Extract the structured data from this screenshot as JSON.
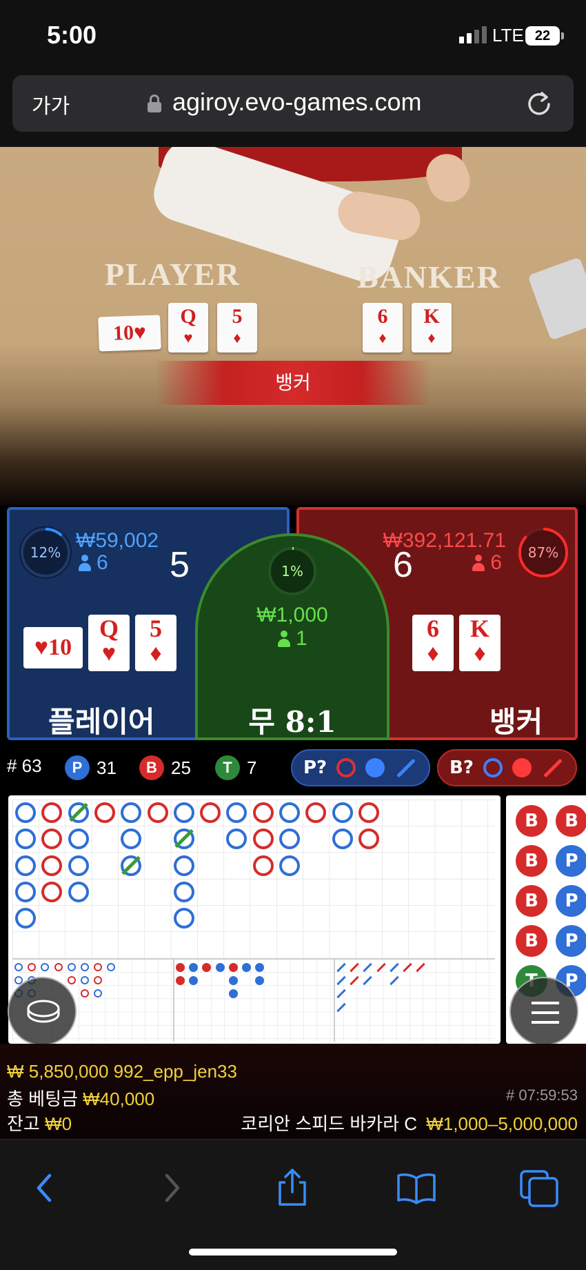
{
  "status": {
    "time": "5:00",
    "network": "LTE",
    "battery": "22"
  },
  "browser": {
    "aa": "가가",
    "url": "agiroy.evo-games.com"
  },
  "video": {
    "player_word": "PLAYER",
    "banker_word": "BANKER",
    "result_banner": "뱅커",
    "player_cards": [
      {
        "rank": "10",
        "suit": "♥"
      },
      {
        "rank": "Q",
        "suit": "♥"
      },
      {
        "rank": "5",
        "suit": "♦"
      }
    ],
    "banker_cards": [
      {
        "rank": "6",
        "suit": "♦"
      },
      {
        "rank": "K",
        "suit": "♦"
      }
    ]
  },
  "player": {
    "percent": "12%",
    "amount": "₩59,002",
    "bettors": "6",
    "score": "5",
    "cards": [
      {
        "rank": "10",
        "suit": "♥"
      },
      {
        "rank": "Q",
        "suit": "♥"
      },
      {
        "rank": "5",
        "suit": "♦"
      }
    ],
    "label": "플레이어",
    "percent_value": 12
  },
  "tie": {
    "percent": "1%",
    "amount": "₩1,000",
    "bettors": "1",
    "label": "무 8:1",
    "percent_value": 1
  },
  "banker": {
    "percent": "87%",
    "amount": "₩392,121.71",
    "bettors": "6",
    "score": "6",
    "cards": [
      {
        "rank": "6",
        "suit": "♦"
      },
      {
        "rank": "K",
        "suit": "♦"
      }
    ],
    "label": "뱅커",
    "percent_value": 87
  },
  "stats": {
    "round_label": "# 63",
    "p_label": "P",
    "p_count": "31",
    "b_label": "B",
    "b_count": "25",
    "t_label": "T",
    "t_count": "7",
    "p_predict": "P?",
    "b_predict": "B?"
  },
  "bead_road": [
    "B",
    "B",
    "B",
    "B",
    "T",
    "B",
    "P",
    "P",
    "P",
    "P"
  ],
  "footer": {
    "win_line": "₩ 5,850,000 992_epp_jen33",
    "total_bet_label": "총 베팅금",
    "total_bet_value": "₩40,000",
    "timestamp": "# 07:59:53",
    "balance_label": "잔고",
    "balance_value": "₩0",
    "table_name": "코리안 스피드 바카라 C",
    "limits": "₩1,000–5,000,000"
  },
  "colors": {
    "player": "#2f6fd6",
    "banker": "#d62b2b",
    "tie": "#3a9a3a",
    "highlight": "#f2d23a"
  },
  "icons": {
    "toolbar": [
      "back-icon",
      "forward-icon",
      "share-icon",
      "bookmarks-icon",
      "tabs-icon"
    ],
    "overlay": [
      "chip-stack-icon",
      "menu-icon"
    ]
  }
}
